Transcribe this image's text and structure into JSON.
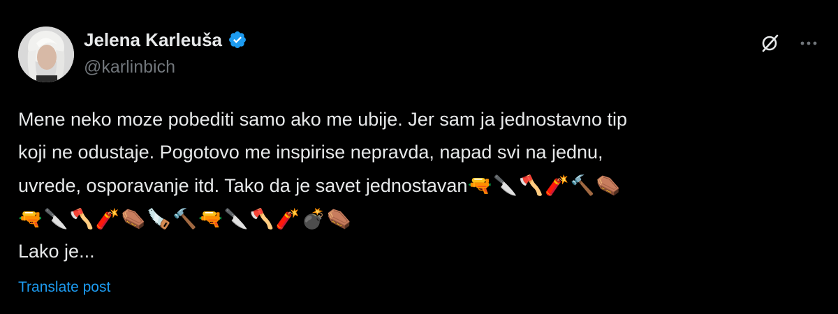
{
  "author": {
    "name": "Jelena Karleuša",
    "handle": "@karlinbich",
    "verified_color": "#1d9bf0"
  },
  "post": {
    "line1": "Mene neko moze pobediti samo ako me ubije. Jer sam ja jednostavno tip",
    "line2": "koji ne odustaje. Pogotovo me inspirise nepravda, napad svi na jednu,",
    "line3": "uvrede, osporavanje itd. Tako da je savet jednostavan",
    "line3_emojis": "🔫🔪🪓🧨🔨⚰️",
    "line4_emojis": "🔫🔪🪓🧨⚰️🪚🔨🔫🔪🪓🧨💣⚰️",
    "line5": "Lako je..."
  },
  "translate_label": "Translate post",
  "icons": {
    "grok": "grok-icon",
    "more": "more-icon",
    "verified": "verified-badge-icon"
  }
}
